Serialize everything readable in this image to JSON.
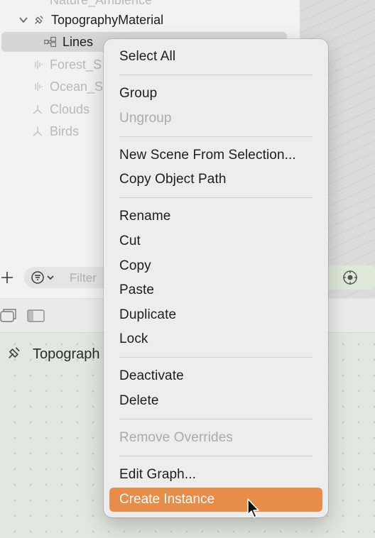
{
  "outline": {
    "items": [
      {
        "label": "Nature_Ambience",
        "state": "dim"
      },
      {
        "label": "TopographyMaterial",
        "state": "normal"
      },
      {
        "label": "Lines",
        "state": "selected"
      },
      {
        "label": "Forest_S",
        "state": "dim"
      },
      {
        "label": "Ocean_S",
        "state": "dim"
      },
      {
        "label": "Clouds",
        "state": "dim"
      },
      {
        "label": "Birds",
        "state": "dim"
      }
    ],
    "filter_placeholder": "Filter"
  },
  "inspector": {
    "title": "Topograph"
  },
  "menu": {
    "items": [
      {
        "label": "Select All",
        "enabled": true
      },
      {
        "label": "Group",
        "enabled": true
      },
      {
        "label": "Ungroup",
        "enabled": false
      },
      {
        "label": "New Scene From Selection...",
        "enabled": true
      },
      {
        "label": "Copy Object Path",
        "enabled": true
      },
      {
        "label": "Rename",
        "enabled": true
      },
      {
        "label": "Cut",
        "enabled": true
      },
      {
        "label": "Copy",
        "enabled": true
      },
      {
        "label": "Paste",
        "enabled": true
      },
      {
        "label": "Duplicate",
        "enabled": true
      },
      {
        "label": "Lock",
        "enabled": true
      },
      {
        "label": "Deactivate",
        "enabled": true
      },
      {
        "label": "Delete",
        "enabled": true
      },
      {
        "label": "Remove Overrides",
        "enabled": false
      },
      {
        "label": "Edit Graph...",
        "enabled": true
      },
      {
        "label": "Create Instance",
        "enabled": true,
        "highlighted": true
      }
    ]
  },
  "colors": {
    "highlight": "#e88c4a",
    "menu_bg": "#ededed"
  },
  "icons": [
    "chevron-down-icon",
    "material-icon",
    "node-graph-icon",
    "audio-icon",
    "transform-icon",
    "plus-icon",
    "filter-icon",
    "viewport-gizmo-icon",
    "sidebar-icon",
    "pointer-cursor-icon"
  ]
}
